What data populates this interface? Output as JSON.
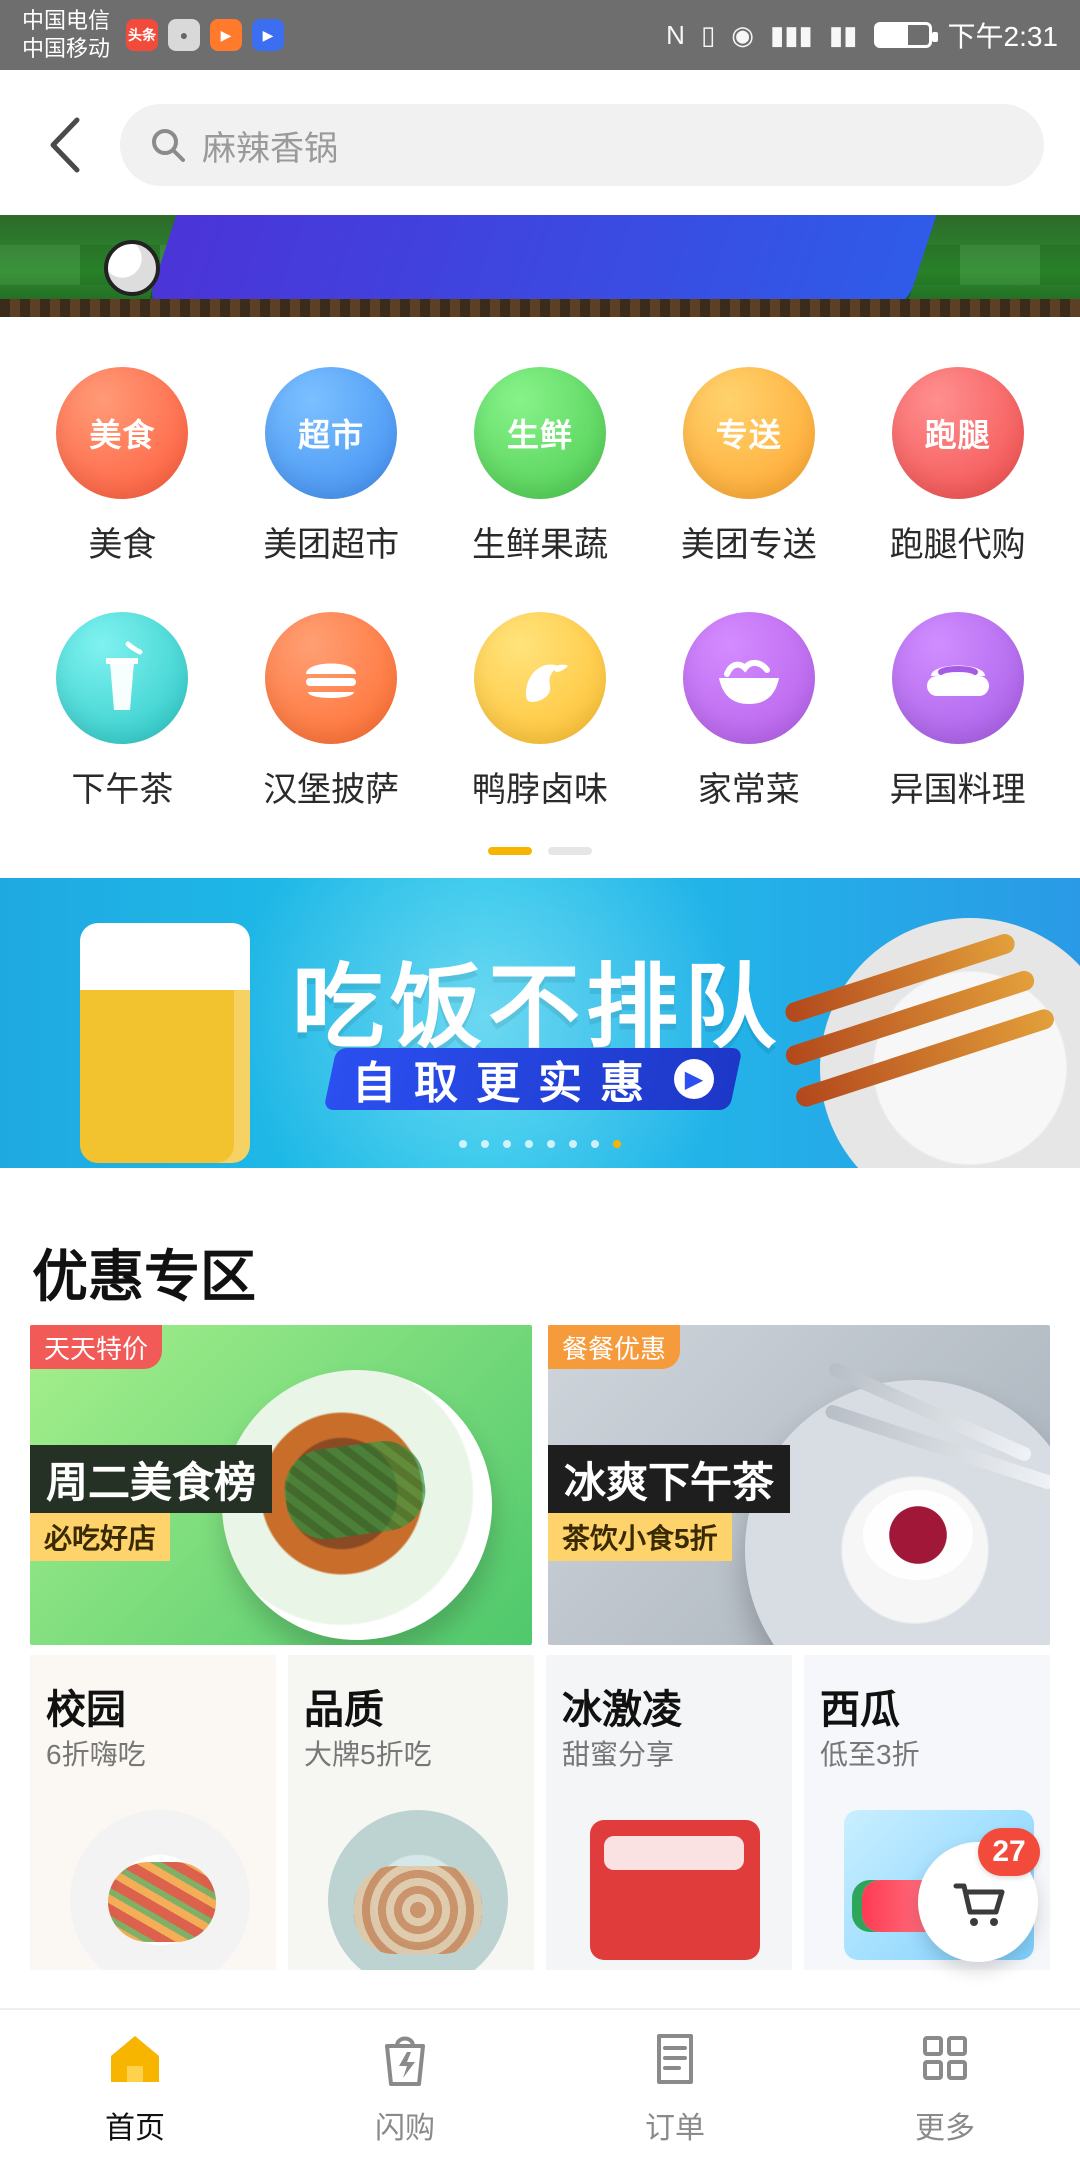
{
  "status_bar": {
    "carrier_1": "中国电信",
    "carrier_2": "中国移动",
    "mini_apps": [
      "头条",
      "",
      "",
      ""
    ],
    "time": "下午2:31",
    "battery_percent": 60
  },
  "search": {
    "placeholder": "麻辣香锅"
  },
  "categories": [
    {
      "label": "美食",
      "icon_text": "美食",
      "color": "#ff5a3a",
      "icon": "food-icon"
    },
    {
      "label": "美团超市",
      "icon_text": "超市",
      "color": "#3f8ef2",
      "icon": "supermarket-icon"
    },
    {
      "label": "生鲜果蔬",
      "icon_text": "生鲜",
      "color": "#4cc94f",
      "icon": "produce-icon"
    },
    {
      "label": "美团专送",
      "icon_text": "专送",
      "color": "#ffa42d",
      "icon": "delivery-icon"
    },
    {
      "label": "跑腿代购",
      "icon_text": "跑腿",
      "color": "#f24b4b",
      "icon": "errand-icon"
    },
    {
      "label": "下午茶",
      "icon_text": "",
      "color": "#29c7c5",
      "icon": "drink-icon"
    },
    {
      "label": "汉堡披萨",
      "icon_text": "",
      "color": "#ff6b2d",
      "icon": "burger-icon"
    },
    {
      "label": "鸭脖卤味",
      "icon_text": "",
      "color": "#ffbf2f",
      "icon": "duck-icon"
    },
    {
      "label": "家常菜",
      "icon_text": "",
      "color": "#b35ee8",
      "icon": "homecooking-icon"
    },
    {
      "label": "异国料理",
      "icon_text": "",
      "color": "#a65be6",
      "icon": "foreign-cuisine-icon"
    }
  ],
  "categories_pager": {
    "active_index": 0,
    "count": 2
  },
  "banner": {
    "title": "吃饭不排队",
    "cta": "自取更实惠",
    "pager_count": 8,
    "pager_active": 7
  },
  "section": {
    "title": "优惠专区"
  },
  "feature_cards": [
    {
      "tag": "天天特价",
      "title": "周二美食榜",
      "subtitle": "必吃好店",
      "tag_style": "red",
      "style": "green"
    },
    {
      "tag": "餐餐优惠",
      "title": "冰爽下午茶",
      "subtitle": "茶饮小食5折",
      "tag_style": "orange",
      "style": "gray"
    }
  ],
  "mini_cards": [
    {
      "title": "校园",
      "subtitle": "6折嗨吃",
      "image": "food"
    },
    {
      "title": "品质",
      "subtitle": "大牌5折吃",
      "image": "oyster"
    },
    {
      "title": "冰激凌",
      "subtitle": "甜蜜分享",
      "image": "ice"
    },
    {
      "title": "西瓜",
      "subtitle": "低至3折",
      "image": "watermelon"
    }
  ],
  "cart": {
    "count": "27"
  },
  "bottom_nav": [
    {
      "label": "首页",
      "active": true,
      "icon": "home-icon"
    },
    {
      "label": "闪购",
      "active": false,
      "icon": "flash-buy-icon"
    },
    {
      "label": "订单",
      "active": false,
      "icon": "orders-icon"
    },
    {
      "label": "更多",
      "active": false,
      "icon": "more-icon"
    }
  ]
}
